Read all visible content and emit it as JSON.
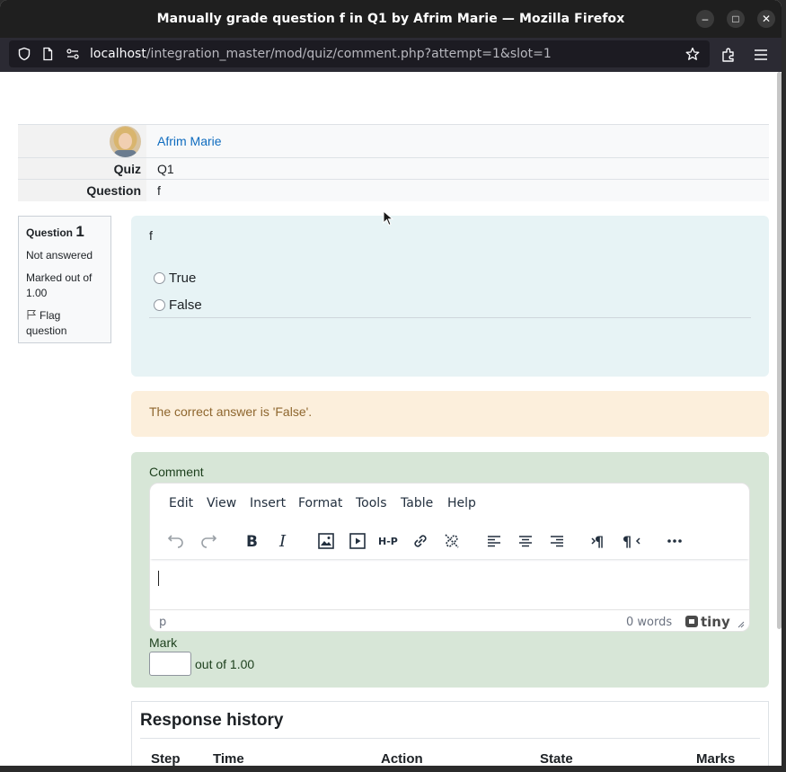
{
  "window": {
    "title": "Manually grade question f in Q1 by Afrim Marie — Mozilla Firefox",
    "minimize_glyph": "–",
    "maximize_glyph": "□",
    "close_glyph": "✕"
  },
  "browser": {
    "url_host": "localhost",
    "url_path": "/integration_master/mod/quiz/comment.php?attempt=1&slot=1"
  },
  "info": {
    "user_name": "Afrim Marie",
    "quiz_label": "Quiz",
    "quiz_value": "Q1",
    "question_label": "Question",
    "question_value": "f"
  },
  "qinfo": {
    "question_word": "Question",
    "question_number": "1",
    "state": "Not answered",
    "marked_out_of": "Marked out of 1.00",
    "flag": "Flag question"
  },
  "question": {
    "text": "f",
    "options": [
      "True",
      "False"
    ]
  },
  "feedback": {
    "correct_answer": "The correct answer is 'False'."
  },
  "comment": {
    "label": "Comment",
    "menu": [
      "Edit",
      "View",
      "Insert",
      "Format",
      "Tools",
      "Table",
      "Help"
    ],
    "status_path": "p",
    "word_count": "0 words",
    "brand": "tiny"
  },
  "mark": {
    "label": "Mark",
    "value": "",
    "out_of": "out of 1.00"
  },
  "history": {
    "title": "Response history",
    "columns": [
      "Step",
      "Time",
      "Action",
      "State",
      "Marks"
    ]
  },
  "colors": {
    "link": "#0f6cbf",
    "formulation_bg": "#e7f3f5",
    "outcome_bg": "#fcefdc",
    "comment_bg": "#d7e6d7"
  }
}
